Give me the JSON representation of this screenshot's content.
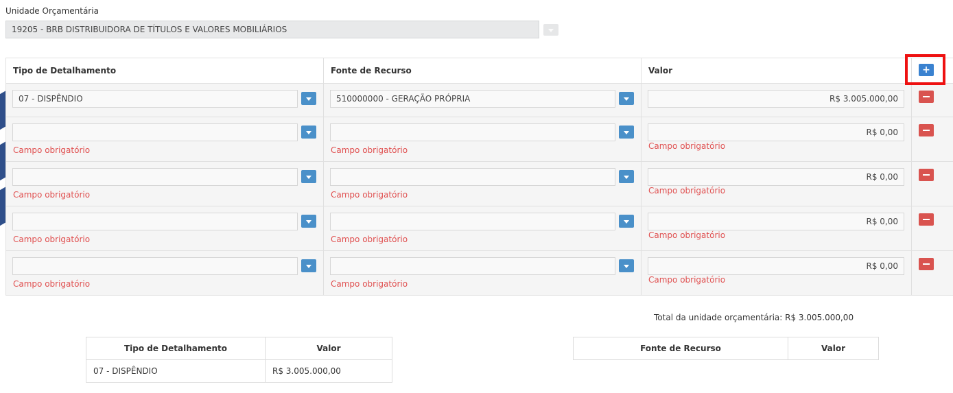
{
  "unit": {
    "label": "Unidade Orçamentária",
    "selected": "19205 - BRB DISTRIBUIDORA DE TÍTULOS E VALORES MOBILIÁRIOS"
  },
  "grid": {
    "headers": {
      "tipo": "Tipo de Detalhamento",
      "fonte": "Fonte de Recurso",
      "valor": "Valor"
    },
    "add_label": "+",
    "rows": [
      {
        "tipo": "07 - DISPÊNDIO",
        "fonte": "510000000 - GERAÇÃO PRÓPRIA",
        "valor": "R$ 3.005.000,00",
        "error": ""
      },
      {
        "tipo": "",
        "fonte": "",
        "valor": "R$ 0,00",
        "error": "Campo obrigatório"
      },
      {
        "tipo": "",
        "fonte": "",
        "valor": "R$ 0,00",
        "error": "Campo obrigatório"
      },
      {
        "tipo": "",
        "fonte": "",
        "valor": "R$ 0,00",
        "error": "Campo obrigatório"
      },
      {
        "tipo": "",
        "fonte": "",
        "valor": "R$ 0,00",
        "error": "Campo obrigatório"
      }
    ]
  },
  "total": "Total da unidade orçamentária: R$ 3.005.000,00",
  "summary_tipo": {
    "headers": [
      "Tipo de Detalhamento",
      "Valor"
    ],
    "rows": [
      [
        "07 - DISPÊNDIO",
        "R$ 3.005.000,00"
      ]
    ]
  },
  "summary_fonte": {
    "headers": [
      "Fonte de Recurso",
      "Valor"
    ],
    "rows": []
  },
  "colors": {
    "accent": "#4a90c9",
    "error": "#e05050",
    "remove": "#d9534f",
    "highlight": "#ee1111"
  },
  "icons": {
    "dropdown": "chevron-down-icon",
    "remove": "minus-icon",
    "add": "plus-icon"
  }
}
